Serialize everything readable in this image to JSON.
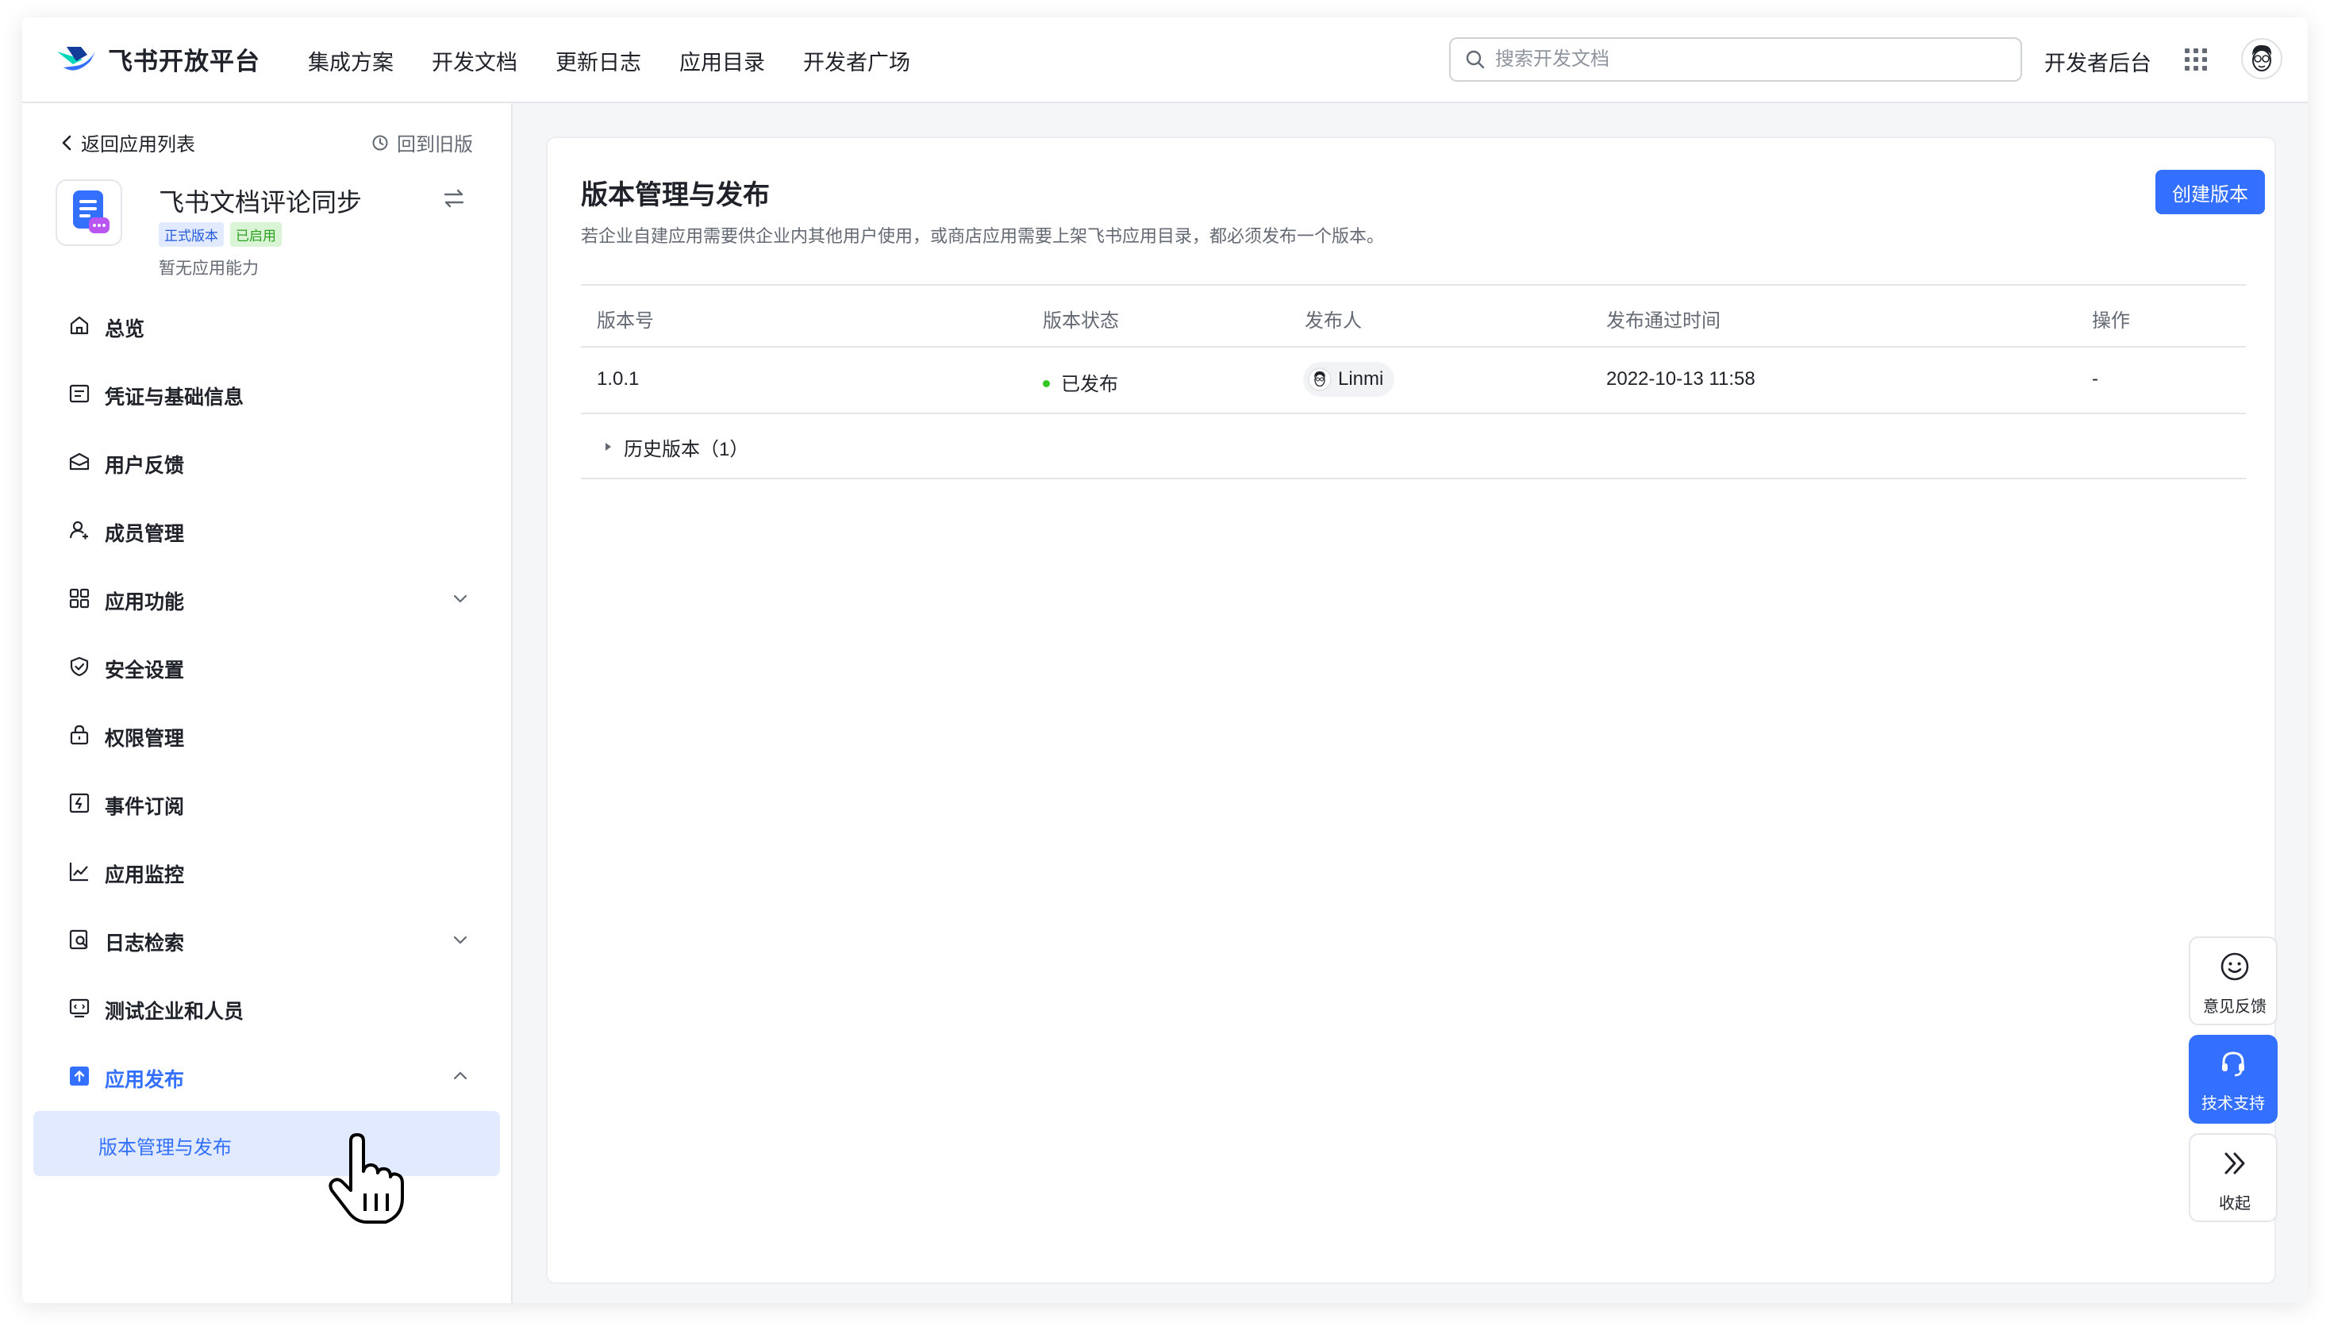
{
  "header": {
    "logo_text": "飞书开放平台",
    "nav": [
      "集成方案",
      "开发文档",
      "更新日志",
      "应用目录",
      "开发者广场"
    ],
    "search_placeholder": "搜索开发文档",
    "dev_console": "开发者后台"
  },
  "sidebar": {
    "back_label": "返回应用列表",
    "old_version_label": "回到旧版",
    "app": {
      "name": "飞书文档评论同步",
      "badge_release": "正式版本",
      "badge_enabled": "已启用",
      "description": "暂无应用能力"
    },
    "items": [
      {
        "label": "总览",
        "icon": "home-icon"
      },
      {
        "label": "凭证与基础信息",
        "icon": "credential-icon"
      },
      {
        "label": "用户反馈",
        "icon": "mail-icon"
      },
      {
        "label": "成员管理",
        "icon": "member-icon"
      },
      {
        "label": "应用功能",
        "icon": "grid-icon",
        "expandable": true
      },
      {
        "label": "安全设置",
        "icon": "shield-icon"
      },
      {
        "label": "权限管理",
        "icon": "lock-icon"
      },
      {
        "label": "事件订阅",
        "icon": "event-icon"
      },
      {
        "label": "应用监控",
        "icon": "chart-icon"
      },
      {
        "label": "日志检索",
        "icon": "log-search-icon",
        "expandable": true
      },
      {
        "label": "测试企业和人员",
        "icon": "test-icon"
      },
      {
        "label": "应用发布",
        "icon": "publish-icon",
        "expanded": true,
        "active": true
      }
    ],
    "subitem": "版本管理与发布"
  },
  "main": {
    "title": "版本管理与发布",
    "description": "若企业自建应用需要供企业内其他用户使用，或商店应用需要上架飞书应用目录，都必须发布一个版本。",
    "create_button": "创建版本",
    "table": {
      "headers": [
        "版本号",
        "版本状态",
        "发布人",
        "发布通过时间",
        "操作"
      ],
      "rows": [
        {
          "version": "1.0.1",
          "status": "已发布",
          "publisher": "Linmi",
          "time": "2022-10-13 11:58",
          "action": "-"
        }
      ],
      "history": "历史版本（1）"
    }
  },
  "widgets": {
    "feedback": "意见反馈",
    "support": "技术支持",
    "collapse": "收起"
  },
  "colors": {
    "accent": "#3370ff",
    "status_published": "#34c724",
    "badge_blue_bg": "#e1eaff",
    "badge_green_bg": "#d9f5d6"
  }
}
